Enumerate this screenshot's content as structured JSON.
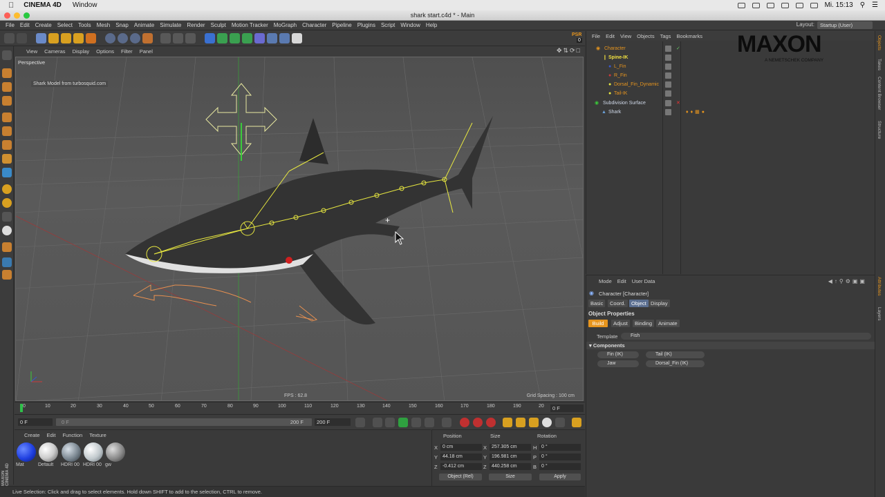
{
  "mac_menubar": {
    "app_name": "CINEMA 4D",
    "menu_item": "Window",
    "clock": "Mi. 15:13"
  },
  "window": {
    "title": "shark start.c4d * - Main"
  },
  "app_menu": {
    "items": [
      "File",
      "Edit",
      "Create",
      "Select",
      "Tools",
      "Mesh",
      "Snap",
      "Animate",
      "Simulate",
      "Render",
      "Sculpt",
      "Motion Tracker",
      "MoGraph",
      "Character",
      "Pipeline",
      "Plugins",
      "Script",
      "Window",
      "Help"
    ],
    "layout_label": "Layout:",
    "layout_value": "Startup (User)"
  },
  "toolbar": {
    "psr_label": "PSR",
    "psr_value": "0"
  },
  "viewport": {
    "menu": [
      "View",
      "Cameras",
      "Display",
      "Options",
      "Filter",
      "Panel"
    ],
    "label": "Perspective",
    "credit": "Shark Model from turbosquid.com",
    "fps": "FPS : 62.8",
    "grid_spacing": "Grid Spacing : 100 cm"
  },
  "timeline": {
    "ticks": [
      "0",
      "10",
      "20",
      "30",
      "40",
      "50",
      "60",
      "70",
      "80",
      "90",
      "100",
      "110",
      "120",
      "130",
      "140",
      "150",
      "160",
      "170",
      "180",
      "190",
      "20"
    ],
    "current_frame": "0 F"
  },
  "transport": {
    "start_field": "0 F",
    "slider_start": "0 F",
    "slider_end": "200 F",
    "end_field": "200 F"
  },
  "material_manager": {
    "menu": [
      "Create",
      "Edit",
      "Function",
      "Texture"
    ],
    "materials": [
      {
        "name": "Mat",
        "color": "#1f3fe0"
      },
      {
        "name": "Default",
        "color": "#dcdcdc"
      },
      {
        "name": "HDRI 00",
        "color": "#9aa6b0"
      },
      {
        "name": "HDRI 00",
        "color": "#c0c8cc"
      },
      {
        "name": "gw",
        "color": "#888888"
      }
    ]
  },
  "coordinates": {
    "headers": {
      "position": "Position",
      "size": "Size",
      "rotation": "Rotation"
    },
    "rows": [
      {
        "axis": "X",
        "pos": "0 cm",
        "size_axis": "X",
        "size": "257.305 cm",
        "rot_axis": "H",
        "rot": "0 °"
      },
      {
        "axis": "Y",
        "pos": "44.18 cm",
        "size_axis": "Y",
        "size": "196.981 cm",
        "rot_axis": "P",
        "rot": "0 °"
      },
      {
        "axis": "Z",
        "pos": "-0.412 cm",
        "size_axis": "Z",
        "size": "440.258 cm",
        "rot_axis": "B",
        "rot": "0 °"
      }
    ],
    "mode_select": "Object (Rel)",
    "size_select": "Size",
    "apply": "Apply"
  },
  "statusbar": {
    "text": "Live Selection: Click and drag to select elements. Hold down SHIFT to add to the selection, CTRL to remove.",
    "logo_text": "MAXON CINEMA 4D"
  },
  "object_manager": {
    "menu": [
      "File",
      "Edit",
      "View",
      "Objects",
      "Tags",
      "Bookmarks"
    ],
    "objects": [
      {
        "name": "Character",
        "color": "#e7951e",
        "indent": 1
      },
      {
        "name": "Spine-IK",
        "color": "#f0e040",
        "indent": 2
      },
      {
        "name": "L_Fin",
        "color": "#e7951e",
        "indent": 3
      },
      {
        "name": "R_Fin",
        "color": "#e7951e",
        "indent": 3
      },
      {
        "name": "Dorsal_Fin_Dynamic",
        "color": "#e7951e",
        "indent": 3
      },
      {
        "name": "Tail-IK",
        "color": "#e7951e",
        "indent": 3
      },
      {
        "name": "Subdivision Surface",
        "color": "#cfd8e8",
        "indent": 0
      },
      {
        "name": "Shark",
        "color": "#cfd8e8",
        "indent": 1
      }
    ],
    "logo": "MAXON",
    "logo_sub": "A NEMETSCHEK COMPANY"
  },
  "attributes": {
    "menu": [
      "Mode",
      "Edit",
      "User Data"
    ],
    "object_title": "Character [Character]",
    "tabs": [
      "Basic",
      "Coord.",
      "Object",
      "Display"
    ],
    "section": "Object Properties",
    "subtabs": [
      "Build",
      "Adjust",
      "Binding",
      "Animate"
    ],
    "template_label": "Template",
    "template_value": "Fish",
    "components_label": "Components",
    "components": [
      "Fin (IK)",
      "Tail (IK)",
      "Jaw",
      "Dorsal_Fin (IK)"
    ]
  },
  "side_tabs": [
    "Objects",
    "Takes",
    "Content Browser",
    "Structure",
    "Attributes",
    "Layers"
  ]
}
